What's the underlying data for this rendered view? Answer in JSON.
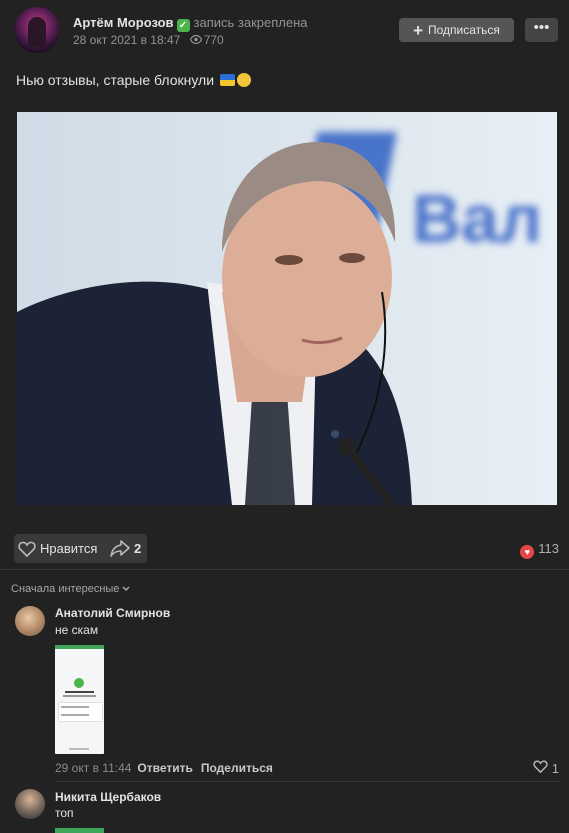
{
  "post": {
    "author": "Артём Морозов",
    "pinned_label": "запись закреплена",
    "date": "28 окт 2021 в 18:47",
    "views": "770",
    "subscribe_label": "Подписаться",
    "more_label": "•••",
    "text": "Нью отзывы, старые блокнули",
    "photo_sign_text": "Вал"
  },
  "actions": {
    "like_label": "Нравится",
    "share_count": "2",
    "likes_total": "113"
  },
  "comments": {
    "sort_label": "Сначала интересные",
    "items": [
      {
        "author": "Анатолий Смирнов",
        "text": "не скам",
        "time": "29 окт в 11:44",
        "reply_label": "Ответить",
        "share_label": "Поделиться",
        "likes": "1"
      },
      {
        "author": "Никита Щербаков",
        "text": "топ"
      }
    ]
  },
  "colors": {
    "background": "#222222",
    "button": "#555555",
    "heart": "#e64646",
    "verified": "#4bb34b"
  }
}
